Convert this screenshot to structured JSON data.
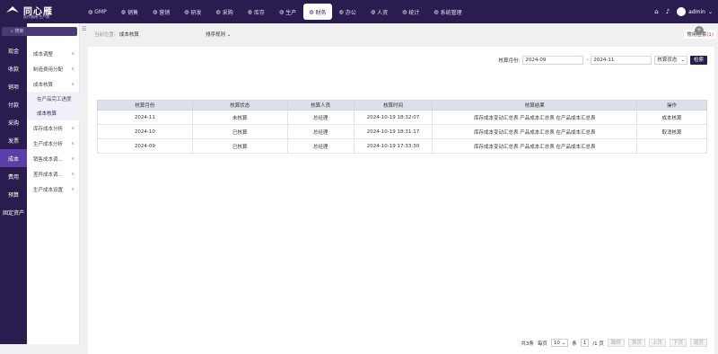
{
  "app": {
    "title": "同心雁",
    "subtitle": "医疗器械·生产商"
  },
  "nav": [
    {
      "label": "GMP",
      "icon": "gmp-icon"
    },
    {
      "label": "销售",
      "icon": "chart-icon"
    },
    {
      "label": "营销",
      "icon": "chart-icon"
    },
    {
      "label": "研发",
      "icon": "chart-icon"
    },
    {
      "label": "采购",
      "icon": "cart-icon"
    },
    {
      "label": "库存",
      "icon": "box-icon"
    },
    {
      "label": "生产",
      "icon": "factory-icon"
    },
    {
      "label": "财务",
      "icon": "money-icon",
      "active": true
    },
    {
      "label": "办公",
      "icon": "briefcase-icon"
    },
    {
      "label": "人资",
      "icon": "user-icon"
    },
    {
      "label": "统计",
      "icon": "clock-icon"
    },
    {
      "label": "系统管理",
      "icon": "gear-icon"
    }
  ],
  "user": {
    "name": "admin"
  },
  "left": [
    "总账",
    "现金",
    "收款",
    "销项",
    "付款",
    "采购",
    "发票",
    "成本",
    "费用",
    "预算",
    "固定资产"
  ],
  "left_active": "成本",
  "sub": {
    "search_placeholder": "搜索",
    "items": [
      {
        "label": "成本调整",
        "chev": "∨"
      },
      {
        "label": "制造费用分配",
        "chev": "∨"
      },
      {
        "label": "成本核算",
        "chev": "∧"
      },
      {
        "label": "库存成本分析",
        "chev": "∨"
      },
      {
        "label": "生产成本分析",
        "chev": "∨"
      },
      {
        "label": "销售成本调...",
        "chev": "∨"
      },
      {
        "label": "差异成本调...",
        "chev": "∨"
      },
      {
        "label": "生产成本设置",
        "chev": "∨"
      }
    ],
    "children": [
      "在产品完工进度",
      "成本核算"
    ]
  },
  "header": {
    "crumb_label": "当前位置:",
    "crumb_page": "成本核算",
    "sort_label": "排序规则",
    "favorites_label": "常用检索",
    "favorites_count": "(1)"
  },
  "filters": {
    "month_label": "核算月份:",
    "start": "2024-09",
    "sep": "-",
    "end": "2024-11",
    "status_label": "核算状态",
    "search_button": "检索"
  },
  "table": {
    "headers": [
      "核算月份",
      "核算状态",
      "核算人员",
      "核算时间",
      "核算结果",
      "操作"
    ],
    "rows": [
      [
        "2024-11",
        "未核算",
        "总经理",
        "2024-10-19 18:32:07",
        "库存成本变动汇总表  产品成本汇总表  在产品成本汇总表",
        "成本核算"
      ],
      [
        "2024-10",
        "已核算",
        "总经理",
        "2024-10-19 18:31:17",
        "库存成本变动汇总表  产品成本汇总表  在产品成本汇总表",
        "取消核算"
      ],
      [
        "2024-09",
        "已核算",
        "总经理",
        "2024-10-19 17:33:30",
        "库存成本变动汇总表  产品成本汇总表  在产品成本汇总表",
        ""
      ]
    ]
  },
  "pager": {
    "total": "共3条",
    "per_page_label": "每页",
    "per_page": "10",
    "unit": "条",
    "page": "1",
    "pages": "/1 页",
    "first": "跳转",
    "prev_first": "首页",
    "prev": "上页",
    "next": "下页",
    "last": "尾页"
  }
}
